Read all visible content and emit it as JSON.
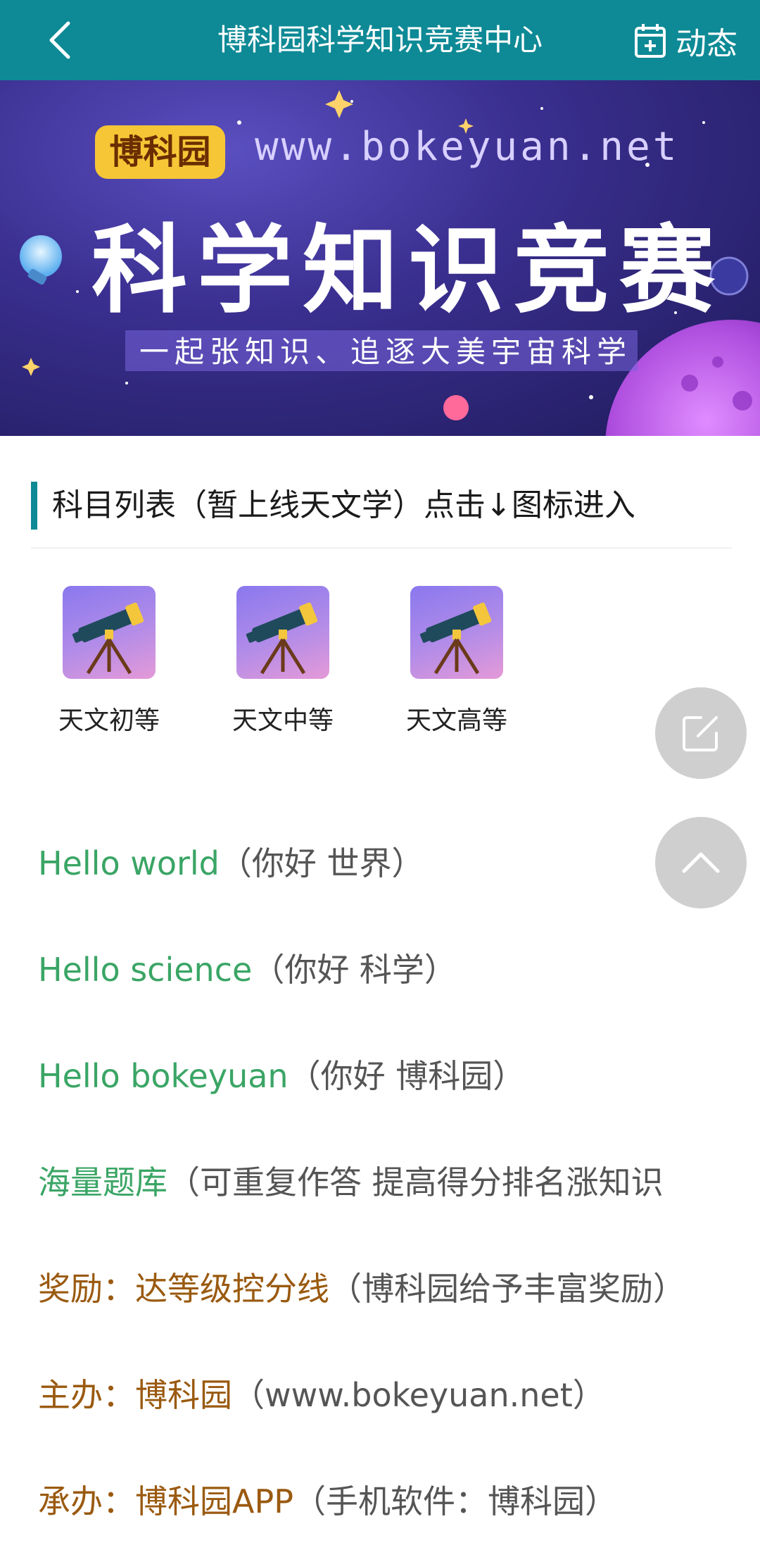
{
  "header": {
    "title": "博科园科学知识竞赛中心",
    "dynamics_label": "动态"
  },
  "banner": {
    "brand": "博科园",
    "url": "www.bokeyuan.net",
    "headline": "科学知识竞赛",
    "slogan": "一起张知识、追逐大美宇宙科学"
  },
  "section": {
    "title": "科目列表（暂上线天文学）点击↓图标进入"
  },
  "subjects": [
    {
      "label": "天文初等",
      "icon": "telescope-icon"
    },
    {
      "label": "天文中等",
      "icon": "telescope-icon"
    },
    {
      "label": "天文高等",
      "icon": "telescope-icon"
    }
  ],
  "fabs": {
    "edit_icon": "edit-icon",
    "scroll_top_icon": "chevron-up-icon"
  },
  "info": [
    {
      "lead": "Hello world",
      "rest": "（你好 世界）"
    },
    {
      "lead": "Hello science",
      "rest": "（你好 科学）"
    },
    {
      "lead": "Hello bokeyuan",
      "rest": "（你好 博科园）"
    },
    {
      "lead": "海量题库",
      "rest": "（可重复作答 提高得分排名涨知识"
    },
    {
      "lead": "奖励：达等级控分线",
      "rest": "（博科园给予丰富奖励）"
    },
    {
      "lead": "主办：博科园",
      "rest": "（www.bokeyuan.net）"
    },
    {
      "lead": "承办：博科园APP",
      "rest": "（手机软件：博科园）"
    }
  ],
  "colors": {
    "header_bg": "#0e8a96",
    "accent_green": "#3aa565",
    "accent_brown": "#9a5a10",
    "text_gray": "#555555",
    "fab_gray": "#cfcfcf"
  }
}
